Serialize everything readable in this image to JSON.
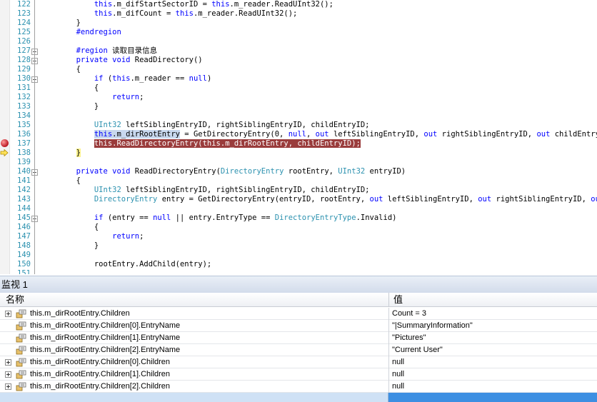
{
  "editor": {
    "lines": [
      {
        "num": "122",
        "html": "            <span class=\"kw\">this</span>.m_difStartSectorID = <span class=\"kw\">this</span>.m_reader.ReadUInt32();"
      },
      {
        "num": "123",
        "html": "            <span class=\"kw\">this</span>.m_difCount = <span class=\"kw\">this</span>.m_reader.ReadUInt32();"
      },
      {
        "num": "124",
        "html": "        }"
      },
      {
        "num": "125",
        "html": "        <span class=\"pp\">#endregion</span>"
      },
      {
        "num": "126",
        "html": ""
      },
      {
        "num": "127",
        "html": "        <span class=\"pp\">#region</span> 读取目录信息"
      },
      {
        "num": "128",
        "html": "        <span class=\"kw\">private</span> <span class=\"kw\">void</span> ReadDirectory()"
      },
      {
        "num": "129",
        "html": "        {"
      },
      {
        "num": "130",
        "html": "            <span class=\"kw\">if</span> (<span class=\"kw\">this</span>.m_reader == <span class=\"kw\">null</span>)"
      },
      {
        "num": "131",
        "html": "            {"
      },
      {
        "num": "132",
        "html": "                <span class=\"kw\">return</span>;"
      },
      {
        "num": "133",
        "html": "            }"
      },
      {
        "num": "134",
        "html": ""
      },
      {
        "num": "135",
        "html": "            <span class=\"ty\">UInt32</span> leftSiblingEntryID, rightSiblingEntryID, childEntryID;"
      },
      {
        "num": "136",
        "html": "            <span class=\"sel\"><span class=\"kw\">this</span>.m_dirRootEntry</span> = GetDirectoryEntry(0, <span class=\"kw\">null</span>, <span class=\"kw\">out</span> leftSiblingEntryID, <span class=\"kw\">out</span> rightSiblingEntryID, <span class=\"kw\">out</span> childEntryID);"
      },
      {
        "num": "137",
        "html": "            <span class=\"bp-line\"><span class=\"kw\">this</span>.ReadDirectoryEntry(<span class=\"kw\">this</span>.m_dirRootEntry, childEntryID);</span>"
      },
      {
        "num": "138",
        "html": "        <span class=\"yel-bracket\">}</span>"
      },
      {
        "num": "139",
        "html": ""
      },
      {
        "num": "140",
        "html": "        <span class=\"kw\">private</span> <span class=\"kw\">void</span> ReadDirectoryEntry(<span class=\"ty\">DirectoryEntry</span> rootEntry, <span class=\"ty\">UInt32</span> entryID)"
      },
      {
        "num": "141",
        "html": "        {"
      },
      {
        "num": "142",
        "html": "            <span class=\"ty\">UInt32</span> leftSiblingEntryID, rightSiblingEntryID, childEntryID;"
      },
      {
        "num": "143",
        "html": "            <span class=\"ty\">DirectoryEntry</span> entry = GetDirectoryEntry(entryID, rootEntry, <span class=\"kw\">out</span> leftSiblingEntryID, <span class=\"kw\">out</span> rightSiblingEntryID, <span class=\"kw\">out</span> chil"
      },
      {
        "num": "144",
        "html": ""
      },
      {
        "num": "145",
        "html": "            <span class=\"kw\">if</span> (entry == <span class=\"kw\">null</span> || entry.EntryType == <span class=\"ty\">DirectoryEntryType</span>.Invalid)"
      },
      {
        "num": "146",
        "html": "            {"
      },
      {
        "num": "147",
        "html": "                <span class=\"kw\">return</span>;"
      },
      {
        "num": "148",
        "html": "            }"
      },
      {
        "num": "149",
        "html": ""
      },
      {
        "num": "150",
        "html": "            rootEntry.AddChild(entry);"
      },
      {
        "num": "151",
        "html": ""
      }
    ]
  },
  "watch": {
    "title": "监视 1",
    "col_name": "名称",
    "col_value": "值",
    "rows": [
      {
        "expandable": true,
        "name": "this.m_dirRootEntry.Children",
        "value": "Count = 3"
      },
      {
        "expandable": false,
        "name": "this.m_dirRootEntry.Children[0].EntryName",
        "value": "\"|SummaryInformation\""
      },
      {
        "expandable": false,
        "name": "this.m_dirRootEntry.Children[1].EntryName",
        "value": "\"Pictures\""
      },
      {
        "expandable": false,
        "name": "this.m_dirRootEntry.Children[2].EntryName",
        "value": "\"Current User\""
      },
      {
        "expandable": true,
        "name": "this.m_dirRootEntry.Children[0].Children",
        "value": "null"
      },
      {
        "expandable": true,
        "name": "this.m_dirRootEntry.Children[1].Children",
        "value": "null"
      },
      {
        "expandable": true,
        "name": "this.m_dirRootEntry.Children[2].Children",
        "value": "null"
      }
    ]
  },
  "colors": {
    "keyword": "#0000ff",
    "type": "#2b91af",
    "line_number": "#2b91af",
    "breakpoint_line": "#9a3c3c",
    "selection": "#c8d8ee",
    "scrollbar": "#3d8fe2"
  }
}
